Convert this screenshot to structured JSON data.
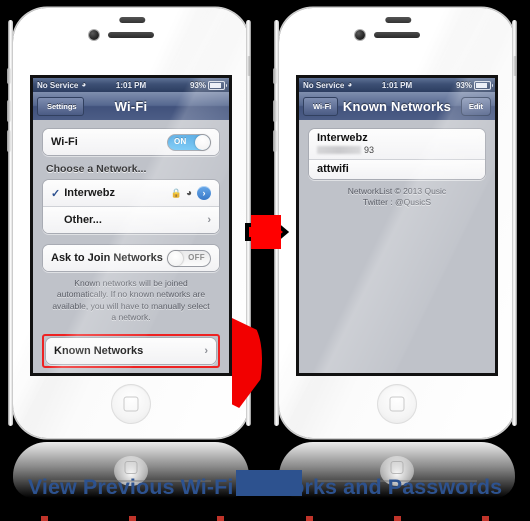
{
  "caption": {
    "text": "View Previous Wi-Fi Networks and Passwords"
  },
  "statusbar": {
    "carrier": "No Service",
    "wifi_icon": "wifi-icon",
    "time": "1:01 PM",
    "battery_percent": "93%",
    "battery_icon": "battery-icon"
  },
  "left_phone": {
    "navbar": {
      "back_label": "Settings",
      "title": "Wi-Fi"
    },
    "wifi_row": {
      "label": "Wi-Fi",
      "toggle_state": "ON"
    },
    "section_header": "Choose a Network...",
    "networks": [
      {
        "name": "Interwebz",
        "checked": true,
        "lock_icon": "lock-icon",
        "signal_icon": "wifi-signal-icon",
        "detail_icon": "chevron-right-circle-icon"
      },
      {
        "name": "Other...",
        "checked": false,
        "chevron_icon": "chevron-right-icon"
      }
    ],
    "ask_row": {
      "label": "Ask to Join Networks",
      "toggle_state": "OFF"
    },
    "footnote": "Known networks will be joined automatically. If no known networks are available, you will have to manually select a network.",
    "known_networks_row": {
      "label": "Known Networks",
      "chevron_icon": "chevron-right-icon",
      "highlight_color": "#ee2222"
    }
  },
  "right_phone": {
    "navbar": {
      "back_label": "Wi-Fi",
      "title": "Known Networks",
      "edit_label": "Edit"
    },
    "networks": [
      {
        "name": "Interwebz",
        "password_redacted": true,
        "password_suffix": "93"
      },
      {
        "name": "attwifi",
        "password_redacted": false,
        "password_suffix": ""
      }
    ],
    "footer": {
      "line1": "NetworkList © 2013 Qusic",
      "line2": "Twitter : @QusicS"
    }
  },
  "arrow": {
    "name": "red-right-arrow",
    "color": "#ff0000"
  }
}
